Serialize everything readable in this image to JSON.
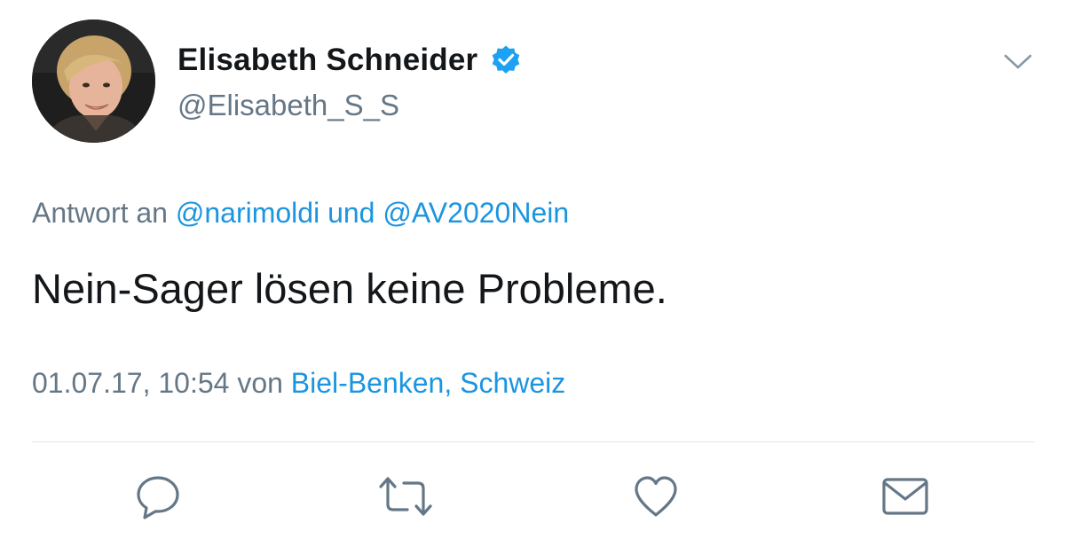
{
  "tweet": {
    "author": {
      "display_name": "Elisabeth Schneider",
      "handle": "@Elisabeth_S_S",
      "verified": true
    },
    "reply": {
      "prefix": "Antwort an",
      "mention_1": "@narimoldi",
      "conjunction": "und",
      "mention_2": "@AV2020Nein"
    },
    "text": "Nein-Sager lösen keine Probleme.",
    "meta": {
      "timestamp": "01.07.17, 10:54",
      "via": "von",
      "location": "Biel-Benken, Schweiz"
    },
    "actions": [
      {
        "name": "reply",
        "icon": "speech-bubble-icon"
      },
      {
        "name": "retweet",
        "icon": "retweet-icon"
      },
      {
        "name": "like",
        "icon": "heart-icon"
      },
      {
        "name": "direct-message",
        "icon": "envelope-icon"
      }
    ]
  },
  "colors": {
    "text_primary": "#14171a",
    "text_secondary": "#657786",
    "link": "#1b95e0",
    "verified_badge": "#1da1f2",
    "divider": "#e1e8ed",
    "icon": "#657786"
  }
}
